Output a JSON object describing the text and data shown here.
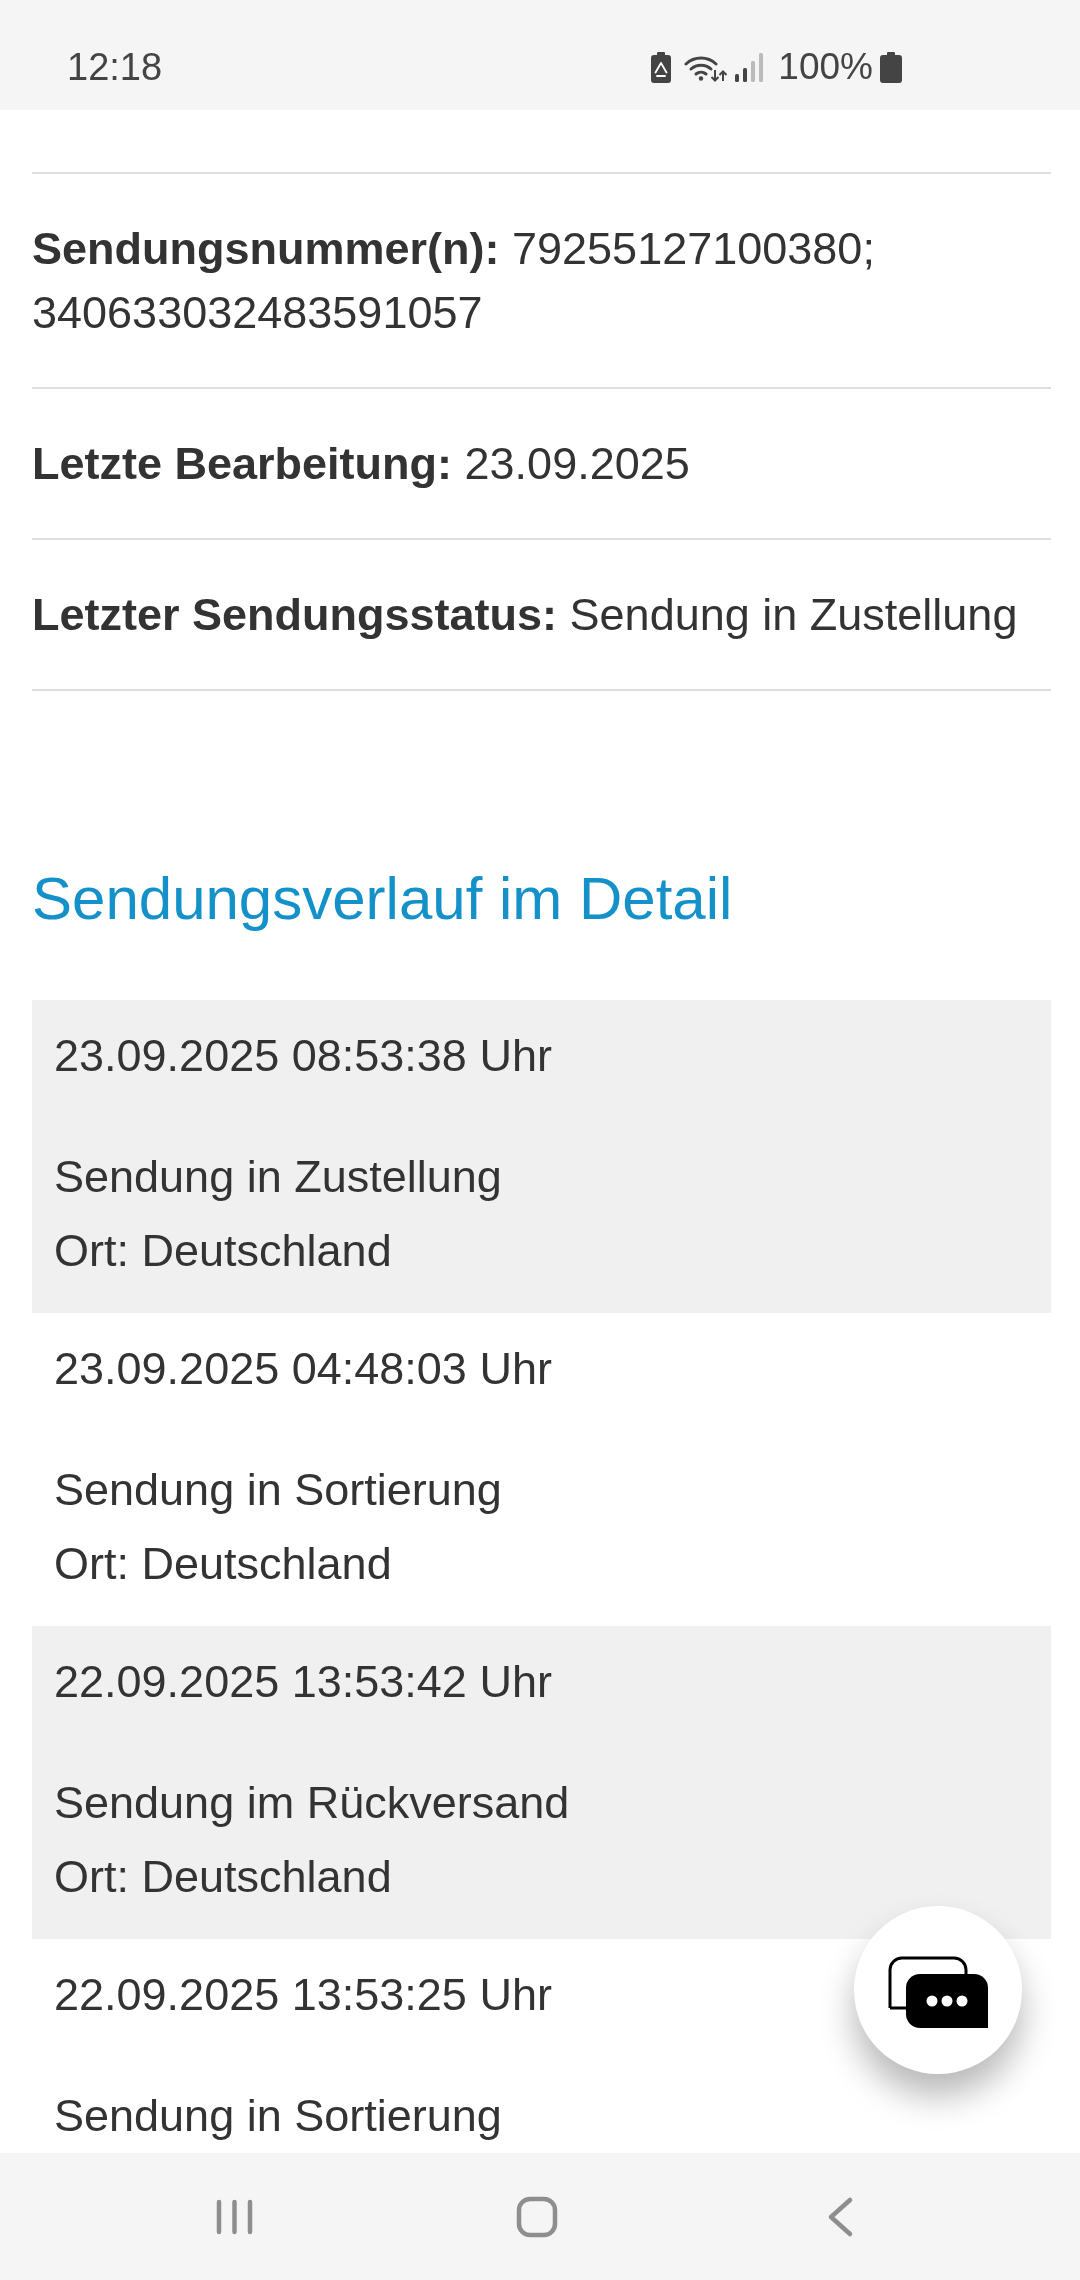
{
  "status_bar": {
    "time": "12:18",
    "battery_percent": "100%"
  },
  "shipment_info": [
    {
      "label": "Sendungsnummer(n):",
      "value": "79255127100380; 340633032483591057"
    },
    {
      "label": "Letzte Bearbeitung:",
      "value": "23.09.2025"
    },
    {
      "label": "Letzter Sendungsstatus:",
      "value": "Sendung in Zustellung"
    }
  ],
  "history": {
    "title": "Sendungsverlauf im Detail",
    "events": [
      {
        "timestamp": "23.09.2025 08:53:38 Uhr",
        "status": "Sendung in Zustellung",
        "location": "Ort: Deutschland"
      },
      {
        "timestamp": "23.09.2025 04:48:03 Uhr",
        "status": "Sendung in Sortierung",
        "location": "Ort: Deutschland"
      },
      {
        "timestamp": "22.09.2025 13:53:42 Uhr",
        "status": "Sendung im Rückversand",
        "location": "Ort: Deutschland"
      },
      {
        "timestamp": "22.09.2025 13:53:25 Uhr",
        "status": "Sendung in Sortierung"
      }
    ]
  }
}
